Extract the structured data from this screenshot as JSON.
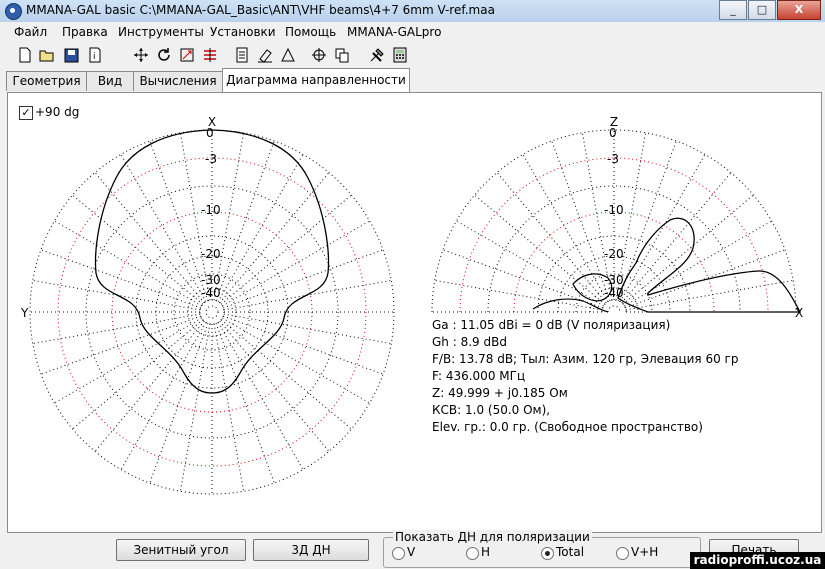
{
  "window": {
    "title": "MMANA-GAL basic C:\\MMANA-GAL_Basic\\ANT\\VHF beams\\4+7 6mm V-ref.maa",
    "buttons": [
      "_",
      "□",
      "X"
    ]
  },
  "menu": [
    "Файл",
    "Правка",
    "Инструменты",
    "Установки",
    "Помощь",
    "MMANA-GALpro"
  ],
  "tabs": [
    {
      "label": "Геометрия",
      "active": false
    },
    {
      "label": "Вид",
      "active": false
    },
    {
      "label": "Вычисления",
      "active": false
    },
    {
      "label": "Диаграмма направленности",
      "active": true
    }
  ],
  "checkbox": {
    "label": "+90 dg",
    "checked": true,
    "mark": "✓"
  },
  "horizontal_plot": {
    "top_label": "X",
    "side_label": "Y",
    "ring_labels": [
      "0",
      "-3",
      "-10",
      "-20",
      "-30",
      "-40"
    ]
  },
  "vertical_plot": {
    "top_label": "Z",
    "side_label": "X",
    "ring_labels": [
      "0",
      "-3",
      "-10",
      "-20",
      "-30",
      "-40"
    ]
  },
  "info_lines": [
    "Ga : 11.05 dBi = 0 dB  (V поляризация)",
    "Gh : 8.9 dBd",
    "F/B: 13.78 dB; Тыл: Азим. 120 гр, Элевация 60 гр",
    "F: 436.000 МГц",
    "Z: 49.999 + j0.185 Ом",
    "КСВ: 1.0 (50.0 Ом),",
    "Elev. гр.: 0.0 гр. (Свободное пространство)"
  ],
  "buttons": {
    "zenith": "Зенитный угол",
    "three_d": "3Д   ДН",
    "print": "Печать"
  },
  "polarization": {
    "title": "Показать ДН для поляризации",
    "options": [
      "V",
      "H",
      "Total",
      "V+H"
    ],
    "selected": "Total"
  },
  "watermark": "radioproffi.ucoz.ua"
}
